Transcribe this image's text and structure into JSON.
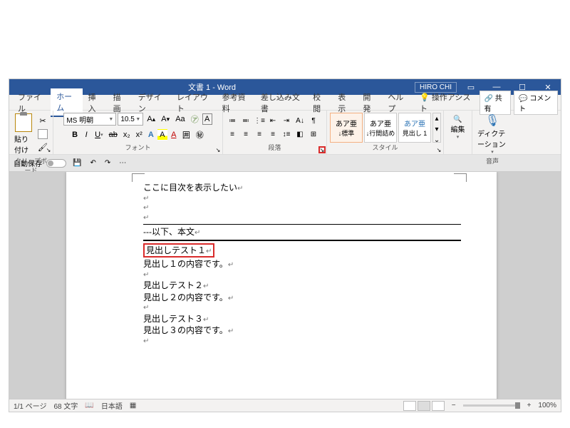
{
  "titlebar": {
    "title": "文書 1  -  Word",
    "user": "HIRO CHI"
  },
  "tabs": {
    "items": [
      "ファイル",
      "ホーム",
      "挿入",
      "描画",
      "デザイン",
      "レイアウト",
      "参考資料",
      "差し込み文書",
      "校閲",
      "表示",
      "開発",
      "ヘルプ"
    ],
    "active_index": 1,
    "tell_me": "操作アシスト",
    "share": "共有",
    "comment": "コメント"
  },
  "ribbon": {
    "clipboard": {
      "paste": "貼り付け",
      "label": "クリップボード"
    },
    "font": {
      "name": "MS 明朝",
      "size": "10.5",
      "label": "フォント"
    },
    "paragraph": {
      "label": "段落"
    },
    "styles": {
      "label": "スタイル",
      "items": [
        {
          "preview": "あア亜",
          "name": "↓標準"
        },
        {
          "preview": "あア亜",
          "name": "↓行間詰め"
        },
        {
          "preview": "あア亜",
          "name": "見出し 1"
        }
      ]
    },
    "editing": {
      "label": "編集"
    },
    "voice": {
      "label": "音声",
      "btn": "ディクテーション"
    }
  },
  "qat": {
    "autosave": "自動保存"
  },
  "document": {
    "lines": {
      "toc_placeholder": "ここに目次を表示したい",
      "divider": "---以下、本文",
      "h1": "見出しテスト１",
      "b1": "見出し１の内容です。",
      "h2": "見出しテスト２",
      "b2": "見出し２の内容です。",
      "h3": "見出しテスト３",
      "b3": "見出し３の内容です。"
    }
  },
  "status": {
    "page": "1/1 ページ",
    "words": "68 文字",
    "lang": "日本語",
    "zoom": "100%"
  }
}
